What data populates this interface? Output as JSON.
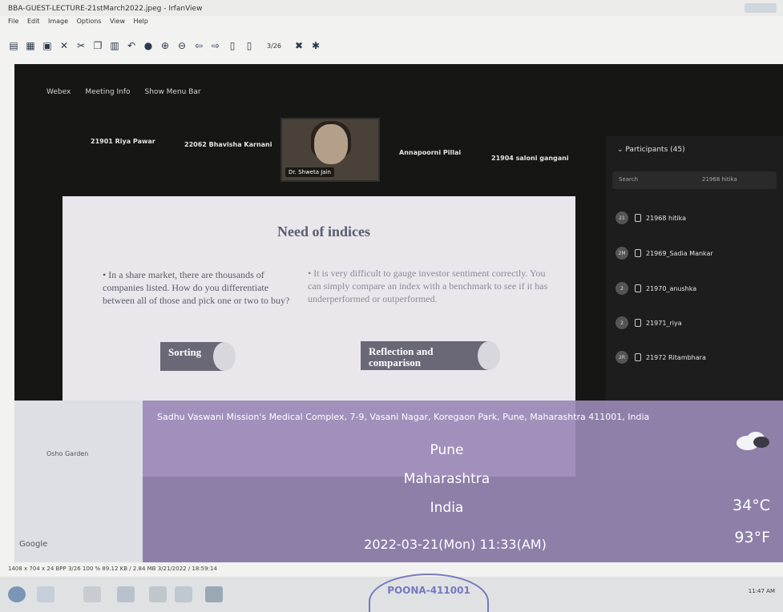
{
  "window": {
    "title": "BBA-GUEST-LECTURE-21stMarch2022.jpeg - IrfanView"
  },
  "menu": [
    "File",
    "Edit",
    "Image",
    "Options",
    "View",
    "Help"
  ],
  "toolbar": {
    "page_counter": "3/26"
  },
  "webex": {
    "top_items": [
      "Webex",
      "Meeting Info",
      "Show Menu Bar"
    ],
    "attendees": [
      "21901 Riya Pawar",
      "22062 Bhavisha Karnani",
      "Annapoorni Pillai",
      "21904 saloni gangani"
    ],
    "presenter_name": "Dr. Shweta Jain",
    "participants_title": "Participants (45)",
    "search_placeholder": "Search",
    "search_hint": "21968 hitika",
    "participants": [
      {
        "initials": "21",
        "name": "21968 hitika"
      },
      {
        "initials": "2M",
        "name": "21969_Sadia Mankar"
      },
      {
        "initials": "2",
        "name": "21970_anushka"
      },
      {
        "initials": "2",
        "name": "21971_riya"
      },
      {
        "initials": "2R",
        "name": "21972 Ritambhara"
      }
    ]
  },
  "slide": {
    "title": "Need of indices",
    "left_text": "• In a share market, there are thousands of companies listed. How do you differentiate between all of those and pick one or two to buy?",
    "right_text": "• It is very difficult to gauge investor sentiment correctly. You can simply compare an index with a benchmark to see if it has underperformed or outperformed.",
    "pill_left": "Sorting",
    "pill_right_line1": "Reflection and",
    "pill_right_line2": "comparison"
  },
  "gps_overlay": {
    "address": "Sadhu Vaswani Mission's Medical Complex, 7-9, Vasani Nagar, Koregaon Park, Pune, Maharashtra 411001, India",
    "city": "Pune",
    "state": "Maharashtra",
    "country": "India",
    "datetime": "2022-03-21(Mon)  11:33(AM)",
    "temp_c": "34°C",
    "temp_f": "93°F"
  },
  "map": {
    "place": "Osho Garden",
    "brand": "Google"
  },
  "statusbar": {
    "text": "1408 x 704 x 24 BPP   3/26   100 %   89.12 KB / 2.84 MB   3/21/2022 / 18:59:14"
  },
  "taskbar": {
    "time": "11:47 AM"
  },
  "stamp": {
    "text": "POONA-411001"
  }
}
